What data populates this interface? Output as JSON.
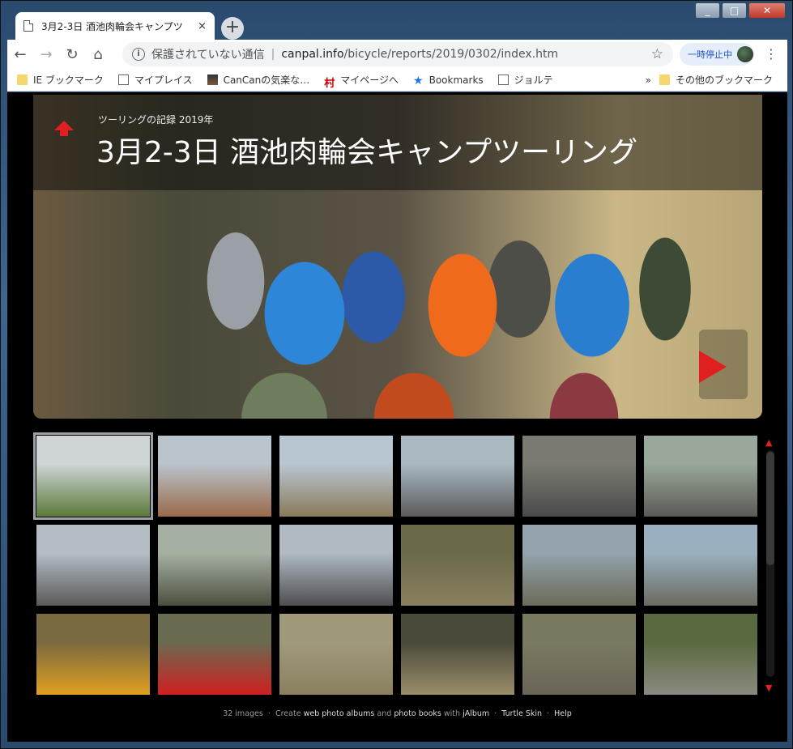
{
  "tab": {
    "title": "3月2-3日 酒池肉輪会キャンプツ",
    "close": "×"
  },
  "toolbar": {
    "security_label": "保護されていない通信",
    "url_host": "canpal.info",
    "url_path": "/bicycle/reports/2019/0302/index.htm",
    "pause_label": "一時停止中"
  },
  "bookmarks": {
    "items": [
      {
        "label": "IE ブックマーク",
        "icon": "folder-icon"
      },
      {
        "label": "マイプレイス",
        "icon": "page-icon"
      },
      {
        "label": "CanCanの気楽な…",
        "icon": "favicon"
      },
      {
        "label": "マイページへ",
        "icon": "kanji-icon",
        "glyph": "村"
      },
      {
        "label": "Bookmarks",
        "icon": "star-icon"
      },
      {
        "label": "ジョルテ",
        "icon": "page-icon"
      }
    ],
    "more": "»",
    "other_label": "その他のブックマーク"
  },
  "hero": {
    "subtitle": "ツーリングの記録 2019年",
    "title": "3月2-3日 酒池肉輪会キャンプツーリング"
  },
  "thumbnails": [
    {
      "top": "#cfd4d6",
      "bottom": "#5b7a3a"
    },
    {
      "top": "#b9c4cc",
      "bottom": "#9a6a4a"
    },
    {
      "top": "#b8c6d2",
      "bottom": "#8a7a5a"
    },
    {
      "top": "#aab8c2",
      "bottom": "#5a5a5a"
    },
    {
      "top": "#7a7a72",
      "bottom": "#4a4a4a"
    },
    {
      "top": "#9aa89a",
      "bottom": "#5a5a56"
    },
    {
      "top": "#b4bcc4",
      "bottom": "#5a5a5a"
    },
    {
      "top": "#a6b0a2",
      "bottom": "#4a5040"
    },
    {
      "top": "#b0bac2",
      "bottom": "#4e4e50"
    },
    {
      "top": "#6a6a48",
      "bottom": "#8a8060"
    },
    {
      "top": "#94a3ae",
      "bottom": "#6a6a58"
    },
    {
      "top": "#9ab0c0",
      "bottom": "#6a6a60"
    },
    {
      "top": "#7a6a40",
      "bottom": "#e0a020"
    },
    {
      "top": "#6a6a50",
      "bottom": "#d02020"
    },
    {
      "top": "#a09a7a",
      "bottom": "#8a8060"
    },
    {
      "top": "#4a4a3a",
      "bottom": "#9a8e6a"
    },
    {
      "top": "#7a7a60",
      "bottom": "#6a6458"
    },
    {
      "top": "#5a6a40",
      "bottom": "#8a8a80"
    }
  ],
  "footer": {
    "count": "32 images",
    "create": "Create",
    "albums": "web photo albums",
    "and": "and",
    "books": "photo books",
    "with": "with",
    "jalbum": "jAlbum",
    "skin": "Turtle Skin",
    "help": "Help",
    "dot": "·"
  },
  "colors": {
    "accent": "#e02020",
    "background": "#000000"
  }
}
